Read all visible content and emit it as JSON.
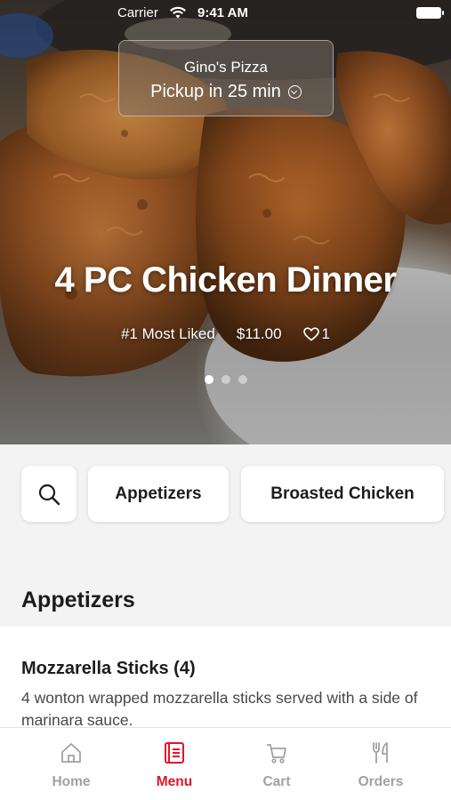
{
  "status_bar": {
    "carrier": "Carrier",
    "time": "9:41 AM"
  },
  "store": {
    "name": "Gino's Pizza",
    "pickup": "Pickup in 25 min"
  },
  "featured": {
    "title": "4 PC Chicken Dinner",
    "tag": "#1 Most Liked",
    "price": "$11.00",
    "likes": "1",
    "slide_count": 3,
    "active_slide": 1
  },
  "categories": [
    {
      "label": "Appetizers"
    },
    {
      "label": "Broasted Chicken"
    }
  ],
  "section": {
    "title": "Appetizers"
  },
  "items": [
    {
      "name": "Mozzarella Sticks (4)",
      "description": "4 wonton wrapped mozzarella sticks served with a side of marinara sauce."
    }
  ],
  "tabs": [
    {
      "label": "Home",
      "icon": "home-icon",
      "active": false
    },
    {
      "label": "Menu",
      "icon": "menu-book-icon",
      "active": true
    },
    {
      "label": "Cart",
      "icon": "cart-icon",
      "active": false
    },
    {
      "label": "Orders",
      "icon": "fork-knife-icon",
      "active": false
    }
  ],
  "colors": {
    "accent": "#e0162b",
    "inactive": "#a1a1a6"
  }
}
